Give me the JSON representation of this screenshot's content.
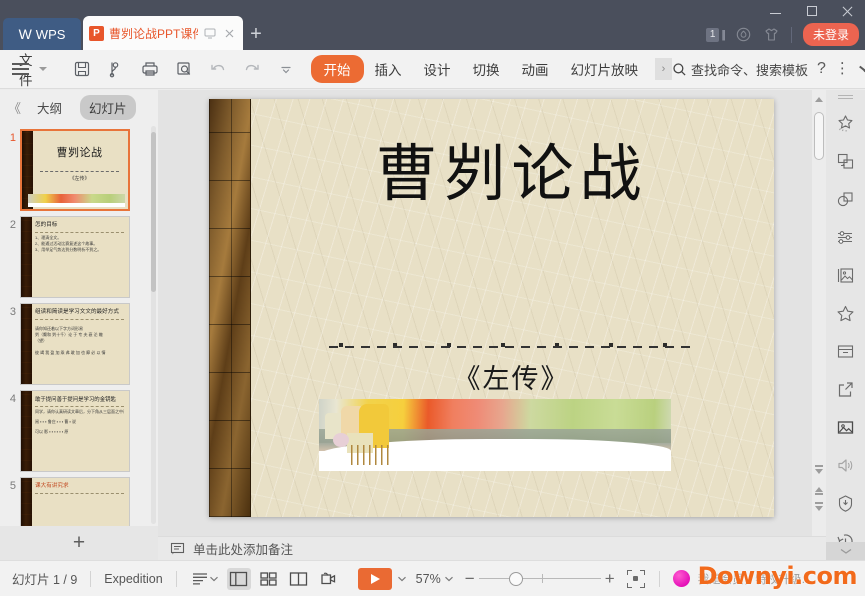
{
  "titlebar": {
    "app_name": "WPS",
    "document_tab": "曹刿论战PPT课件.ppt",
    "new_tab_label": "+",
    "tab_count": "1",
    "login_label": "未登录",
    "icons": [
      "monitor-icon",
      "close-icon",
      "backup-icon",
      "skin-icon"
    ]
  },
  "ribbon": {
    "file_label": "文件",
    "quick_access": [
      "save-icon",
      "save-as-icon",
      "print-icon",
      "print-preview-icon",
      "undo-icon",
      "redo-icon",
      "customize-caret-icon"
    ],
    "tabs": [
      {
        "label": "开始",
        "active": true
      },
      {
        "label": "插入",
        "active": false
      },
      {
        "label": "设计",
        "active": false
      },
      {
        "label": "切换",
        "active": false
      },
      {
        "label": "动画",
        "active": false
      },
      {
        "label": "幻灯片放映",
        "active": false
      }
    ],
    "more_tabs_label": "›",
    "search_placeholder": "查找命令、搜索模板",
    "help_label": "?",
    "accent_color": "#ec6b33"
  },
  "left_panel": {
    "collapse_label": "《",
    "tabs": [
      {
        "label": "大纲",
        "active": false
      },
      {
        "label": "幻灯片",
        "active": true
      }
    ],
    "add_slide_label": "+",
    "thumbnails": [
      {
        "number": "1",
        "selected": true,
        "title": "曹刿论战",
        "subtitle": "《左传》",
        "lines": []
      },
      {
        "number": "2",
        "selected": false,
        "title": "怎的目标",
        "subtitle": "",
        "lines": [
          "1、理清全文。",
          "2、能通过活动比赛复述这个故事。",
          "3、用举足气势达到分数明析不到之。"
        ]
      },
      {
        "number": "3",
        "selected": false,
        "title": "组读和简读是学习文文的最好方式",
        "subtitle": "",
        "lines": [
          "请你知还着以下字方词形易",
          "刿（黧和 刿十千）论 于 专 夫 衰 沦 辙",
          "（望）",
          "彼 竭 我 盈 加 乘 弗 敢 加 也 靡 必 以 情"
        ]
      },
      {
        "number": "4",
        "selected": false,
        "title": "敢于提问善于提问是学习的金钥匙",
        "subtitle": "",
        "lines": [
          "同学，请你认真研读文章后，分下角从三层面之中请提出至少三个以上有价值的问题",
          "阅 ▪ ▪ ▪ 鲁庄 ▪ ▪ ▪ 曹 ▪ 说",
          "可以 影 ▪ ▪ ▪ ▪ ▪ ▪ 原"
        ]
      },
      {
        "number": "5",
        "selected": false,
        "title": "课大有讲究求",
        "subtitle": "",
        "lines": []
      }
    ]
  },
  "slide": {
    "title": "曹刿论战",
    "subtitle": "《左传》",
    "has_divider": true,
    "image_alt": "ancient-battle-illustration"
  },
  "right_rail": {
    "icons": [
      "smart-effect-icon",
      "duplicate-shape-icon",
      "shape-combine-icon",
      "adjust-settings-icon",
      "picture-frame-icon",
      "favorite-star-icon",
      "archive-box-icon",
      "share-export-icon",
      "insert-image-icon",
      "audio-icon",
      "security-shield-icon",
      "history-icon"
    ],
    "collapse_label": "⌄"
  },
  "notes": {
    "placeholder": "单击此处添加备注",
    "icon": "notes-icon"
  },
  "status": {
    "slide_counter": "幻灯片 1 / 9",
    "theme_name": "Expedition",
    "outline_icon": "outline-list-icon",
    "view_buttons": [
      {
        "name": "normal-view",
        "active": true
      },
      {
        "name": "slide-sorter-view",
        "active": false
      },
      {
        "name": "reading-view",
        "active": false
      },
      {
        "name": "presenter-view",
        "active": false
      }
    ],
    "play_label": "▶",
    "zoom_level": "57%",
    "zoom_minus": "−",
    "zoom_plus": "+",
    "fit_icon": "fit-to-window-icon",
    "promo_text": "我是会员，特权升级…",
    "watermark": "Downyi.com"
  }
}
